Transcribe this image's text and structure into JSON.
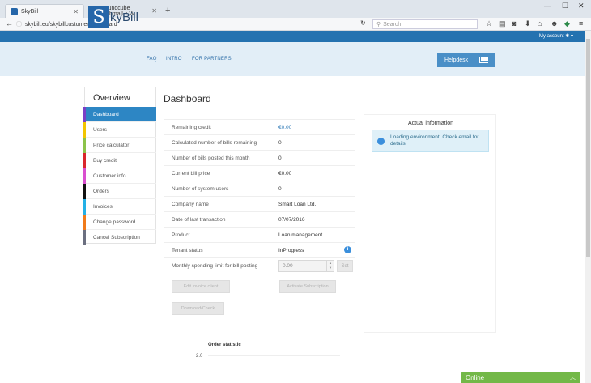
{
  "browser": {
    "tabs": [
      {
        "title": "SkyBill",
        "active": true
      },
      {
        "title": "Roundcube Webmail :: W...",
        "active": false
      }
    ],
    "url": "skybill.eu/skybillcustomer/dashboard",
    "search_placeholder": "Search"
  },
  "site": {
    "account_label": "My account",
    "logo_letter": "S",
    "logo_text": "kyBill",
    "nav": [
      "FAQ",
      "INTRO",
      "FOR PARTNERS"
    ],
    "helpdesk_label": "Helpdesk"
  },
  "sidebar": {
    "title": "Overview",
    "items": [
      {
        "label": "Dashboard",
        "color": "#7a3fc7",
        "active": true
      },
      {
        "label": "Users",
        "color": "#f2c500",
        "active": false
      },
      {
        "label": "Price calculator",
        "color": "#8cc34a",
        "active": false
      },
      {
        "label": "Buy credit",
        "color": "#d9262c",
        "active": false
      },
      {
        "label": "Customer info",
        "color": "#d94fcf",
        "active": false
      },
      {
        "label": "Orders",
        "color": "#111111",
        "active": false
      },
      {
        "label": "Invoices",
        "color": "#23b0e6",
        "active": false
      },
      {
        "label": "Change password",
        "color": "#f07a1a",
        "active": false
      },
      {
        "label": "Cancel Subscription",
        "color": "#6b6f80",
        "active": false
      }
    ]
  },
  "dashboard": {
    "title": "Dashboard",
    "rows": [
      {
        "label": "Remaining credit",
        "value": "€0.00"
      },
      {
        "label": "Calculated number of bills remaining",
        "value": "0"
      },
      {
        "label": "Number of bills posted this month",
        "value": "0"
      },
      {
        "label": "Current bill price",
        "value": "€0.00"
      },
      {
        "label": "Number of system users",
        "value": "0"
      },
      {
        "label": "Company name",
        "value": "Smart Loan Ltd."
      },
      {
        "label": "Date of last transaction",
        "value": "07/07/2016"
      },
      {
        "label": "Product",
        "value": "Loan management"
      },
      {
        "label": "Tenant status",
        "value": "InProgress"
      }
    ],
    "limit": {
      "label": "Monthly spending limit for bill posting",
      "value": "0.00",
      "set_label": "Set"
    },
    "buttons": {
      "edit_invoice": "Edit Invoice client",
      "activate": "Activate Subscription",
      "download": "Download/Check"
    }
  },
  "actual": {
    "title": "Actual information",
    "message": "Loading environment. Check email for details."
  },
  "chart_data": {
    "type": "line",
    "title": "Order statistic",
    "y_tick_labels": [
      "2.0"
    ],
    "series": []
  },
  "chat": {
    "label": "Online"
  }
}
